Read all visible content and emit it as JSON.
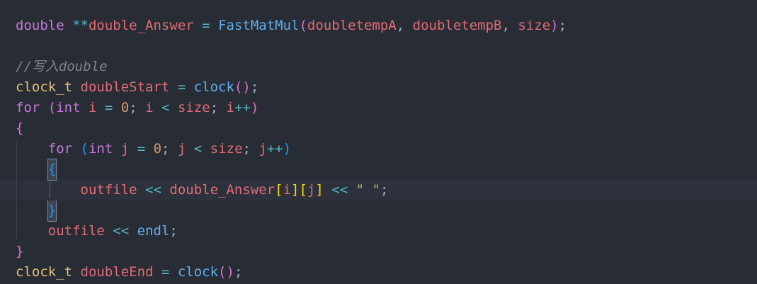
{
  "editor": {
    "colors": {
      "background": "#282c34",
      "keyword": "#c678dd",
      "type": "#e5c07b",
      "variable": "#e06c75",
      "function": "#61afef",
      "operator": "#56b6c2",
      "number": "#d19a66",
      "string": "#98c379",
      "comment": "#7f848e"
    },
    "lines": [
      {
        "tokens": [
          {
            "t": "double",
            "c": "kw"
          },
          {
            "t": " ",
            "c": "pun"
          },
          {
            "t": "**",
            "c": "op"
          },
          {
            "t": "double_Answer",
            "c": "var"
          },
          {
            "t": " ",
            "c": "pun"
          },
          {
            "t": "=",
            "c": "op"
          },
          {
            "t": " ",
            "c": "pun"
          },
          {
            "t": "FastMatMul",
            "c": "fn"
          },
          {
            "t": "(",
            "c": "b2"
          },
          {
            "t": "doubletempA",
            "c": "var"
          },
          {
            "t": ", ",
            "c": "pun"
          },
          {
            "t": "doubletempB",
            "c": "var"
          },
          {
            "t": ", ",
            "c": "pun"
          },
          {
            "t": "size",
            "c": "var"
          },
          {
            "t": ")",
            "c": "b2"
          },
          {
            "t": ";",
            "c": "pun"
          }
        ]
      },
      {
        "tokens": []
      },
      {
        "tokens": [
          {
            "t": "//写入double",
            "c": "cm"
          }
        ]
      },
      {
        "tokens": [
          {
            "t": "clock_t",
            "c": "type"
          },
          {
            "t": " ",
            "c": "pun"
          },
          {
            "t": "doubleStart",
            "c": "var"
          },
          {
            "t": " ",
            "c": "pun"
          },
          {
            "t": "=",
            "c": "op"
          },
          {
            "t": " ",
            "c": "pun"
          },
          {
            "t": "clock",
            "c": "fn"
          },
          {
            "t": "()",
            "c": "b2"
          },
          {
            "t": ";",
            "c": "pun"
          }
        ]
      },
      {
        "tokens": [
          {
            "t": "for",
            "c": "kw"
          },
          {
            "t": " ",
            "c": "pun"
          },
          {
            "t": "(",
            "c": "b2"
          },
          {
            "t": "int",
            "c": "kw"
          },
          {
            "t": " ",
            "c": "pun"
          },
          {
            "t": "i",
            "c": "var"
          },
          {
            "t": " ",
            "c": "pun"
          },
          {
            "t": "=",
            "c": "op"
          },
          {
            "t": " ",
            "c": "pun"
          },
          {
            "t": "0",
            "c": "num"
          },
          {
            "t": "; ",
            "c": "pun"
          },
          {
            "t": "i",
            "c": "var"
          },
          {
            "t": " ",
            "c": "pun"
          },
          {
            "t": "<",
            "c": "op"
          },
          {
            "t": " ",
            "c": "pun"
          },
          {
            "t": "size",
            "c": "var"
          },
          {
            "t": "; ",
            "c": "pun"
          },
          {
            "t": "i",
            "c": "var"
          },
          {
            "t": "++",
            "c": "op"
          },
          {
            "t": ")",
            "c": "b2"
          }
        ]
      },
      {
        "tokens": [
          {
            "t": "{",
            "c": "b2"
          }
        ]
      },
      {
        "tokens": [
          {
            "t": "    ",
            "c": "pun"
          },
          {
            "t": "for",
            "c": "kw"
          },
          {
            "t": " ",
            "c": "pun"
          },
          {
            "t": "(",
            "c": "b3"
          },
          {
            "t": "int",
            "c": "kw"
          },
          {
            "t": " ",
            "c": "pun"
          },
          {
            "t": "j",
            "c": "var"
          },
          {
            "t": " ",
            "c": "pun"
          },
          {
            "t": "=",
            "c": "op"
          },
          {
            "t": " ",
            "c": "pun"
          },
          {
            "t": "0",
            "c": "num"
          },
          {
            "t": "; ",
            "c": "pun"
          },
          {
            "t": "j",
            "c": "var"
          },
          {
            "t": " ",
            "c": "pun"
          },
          {
            "t": "<",
            "c": "op"
          },
          {
            "t": " ",
            "c": "pun"
          },
          {
            "t": "size",
            "c": "var"
          },
          {
            "t": "; ",
            "c": "pun"
          },
          {
            "t": "j",
            "c": "var"
          },
          {
            "t": "++",
            "c": "op"
          },
          {
            "t": ")",
            "c": "b3"
          }
        ]
      },
      {
        "tokens": [
          {
            "t": "    ",
            "c": "pun"
          },
          {
            "t": "{",
            "c": "b3",
            "hl": true
          }
        ]
      },
      {
        "current": true,
        "tokens": [
          {
            "t": "        ",
            "c": "pun"
          },
          {
            "t": "outfile",
            "c": "var"
          },
          {
            "t": " ",
            "c": "pun"
          },
          {
            "t": "<<",
            "c": "op"
          },
          {
            "t": " ",
            "c": "pun"
          },
          {
            "t": "double_Answer",
            "c": "var"
          },
          {
            "t": "[",
            "c": "b1"
          },
          {
            "t": "i",
            "c": "var"
          },
          {
            "t": "]",
            "c": "b1"
          },
          {
            "t": "[",
            "c": "b1"
          },
          {
            "t": "j",
            "c": "var"
          },
          {
            "t": "]",
            "c": "b1"
          },
          {
            "t": " ",
            "c": "pun"
          },
          {
            "t": "<<",
            "c": "op"
          },
          {
            "t": " ",
            "c": "pun"
          },
          {
            "t": "\" \"",
            "c": "str"
          },
          {
            "t": ";",
            "c": "pun"
          }
        ]
      },
      {
        "tokens": [
          {
            "t": "    ",
            "c": "pun"
          },
          {
            "t": "}",
            "c": "b3",
            "hl": true
          }
        ]
      },
      {
        "tokens": [
          {
            "t": "    ",
            "c": "pun"
          },
          {
            "t": "outfile",
            "c": "var"
          },
          {
            "t": " ",
            "c": "pun"
          },
          {
            "t": "<<",
            "c": "op"
          },
          {
            "t": " ",
            "c": "pun"
          },
          {
            "t": "endl",
            "c": "fn"
          },
          {
            "t": ";",
            "c": "pun"
          }
        ]
      },
      {
        "tokens": [
          {
            "t": "}",
            "c": "b2"
          }
        ]
      },
      {
        "tokens": [
          {
            "t": "clock_t",
            "c": "type"
          },
          {
            "t": " ",
            "c": "pun"
          },
          {
            "t": "doubleEnd",
            "c": "var"
          },
          {
            "t": " ",
            "c": "pun"
          },
          {
            "t": "=",
            "c": "op"
          },
          {
            "t": " ",
            "c": "pun"
          },
          {
            "t": "clock",
            "c": "fn"
          },
          {
            "t": "()",
            "c": "b2"
          },
          {
            "t": ";",
            "c": "pun"
          }
        ]
      }
    ]
  }
}
